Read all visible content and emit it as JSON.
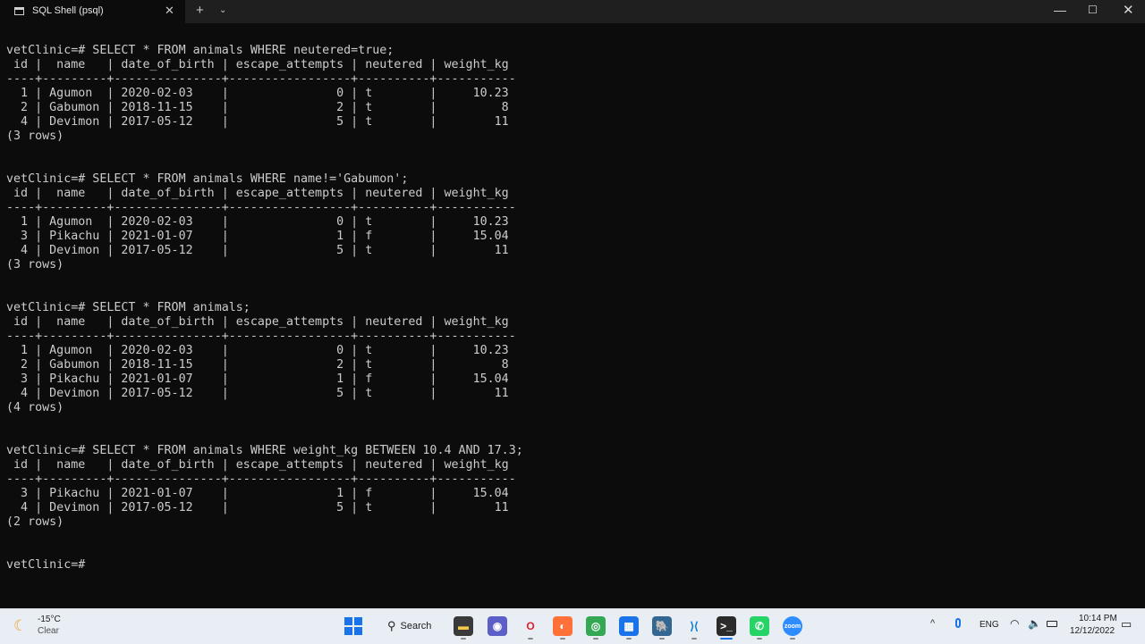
{
  "window": {
    "tab_title": "SQL Shell (psql)",
    "tab_close": "✕",
    "new_tab": "+",
    "tab_dropdown": "⌄",
    "minimize": "—",
    "maximize": "☐",
    "close": "✕"
  },
  "terminal": {
    "lines": [
      "vetClinic=# SELECT * FROM animals WHERE neutered=true;",
      " id |  name   | date_of_birth | escape_attempts | neutered | weight_kg",
      "----+---------+---------------+-----------------+----------+-----------",
      "  1 | Agumon  | 2020-02-03    |               0 | t        |     10.23",
      "  2 | Gabumon | 2018-11-15    |               2 | t        |         8",
      "  4 | Devimon | 2017-05-12    |               5 | t        |        11",
      "(3 rows)",
      "",
      "",
      "vetClinic=# SELECT * FROM animals WHERE name!='Gabumon';",
      " id |  name   | date_of_birth | escape_attempts | neutered | weight_kg",
      "----+---------+---------------+-----------------+----------+-----------",
      "  1 | Agumon  | 2020-02-03    |               0 | t        |     10.23",
      "  3 | Pikachu | 2021-01-07    |               1 | f        |     15.04",
      "  4 | Devimon | 2017-05-12    |               5 | t        |        11",
      "(3 rows)",
      "",
      "",
      "vetClinic=# SELECT * FROM animals;",
      " id |  name   | date_of_birth | escape_attempts | neutered | weight_kg",
      "----+---------+---------------+-----------------+----------+-----------",
      "  1 | Agumon  | 2020-02-03    |               0 | t        |     10.23",
      "  2 | Gabumon | 2018-11-15    |               2 | t        |         8",
      "  3 | Pikachu | 2021-01-07    |               1 | f        |     15.04",
      "  4 | Devimon | 2017-05-12    |               5 | t        |        11",
      "(4 rows)",
      "",
      "",
      "vetClinic=# SELECT * FROM animals WHERE weight_kg BETWEEN 10.4 AND 17.3;",
      " id |  name   | date_of_birth | escape_attempts | neutered | weight_kg",
      "----+---------+---------------+-----------------+----------+-----------",
      "  3 | Pikachu | 2021-01-07    |               1 | f        |     15.04",
      "  4 | Devimon | 2017-05-12    |               5 | t        |        11",
      "(2 rows)",
      "",
      "",
      "vetClinic=#"
    ]
  },
  "taskbar": {
    "weather": {
      "icon": "moon-icon",
      "temp": "-15°C",
      "desc": "Clear"
    },
    "search_label": "Search",
    "apps": [
      {
        "name": "file-explorer",
        "glyph": "▬",
        "color": "#3a3a3a",
        "fg": "#f2c94c"
      },
      {
        "name": "teams-chat",
        "glyph": "◉",
        "color": "#5b5fc7",
        "fg": "#ffffff"
      },
      {
        "name": "opera",
        "glyph": "O",
        "color": "#e9eef5",
        "fg": "#e0202e"
      },
      {
        "name": "firefox",
        "glyph": "◐",
        "color": "#ff7139",
        "fg": "#ffffff"
      },
      {
        "name": "chrome",
        "glyph": "◎",
        "color": "#34a853",
        "fg": "#ffffff"
      },
      {
        "name": "control-panel",
        "glyph": "▦",
        "color": "#1a73e8",
        "fg": "#ffffff"
      },
      {
        "name": "pgadmin",
        "glyph": "🐘",
        "color": "#336791",
        "fg": "#ffffff"
      },
      {
        "name": "vscode",
        "glyph": "⟩⟨",
        "color": "#e9eef5",
        "fg": "#0078d4"
      },
      {
        "name": "terminal",
        "glyph": ">_",
        "color": "#2b2b2b",
        "fg": "#ffffff"
      },
      {
        "name": "whatsapp",
        "glyph": "✆",
        "color": "#25d366",
        "fg": "#ffffff"
      },
      {
        "name": "zoom",
        "glyph": "zoom",
        "color": "#2d8cff",
        "fg": "#ffffff"
      }
    ],
    "tray": {
      "chevron": "^",
      "language": "ENG",
      "time": "10:14 PM",
      "date": "12/12/2022"
    }
  }
}
